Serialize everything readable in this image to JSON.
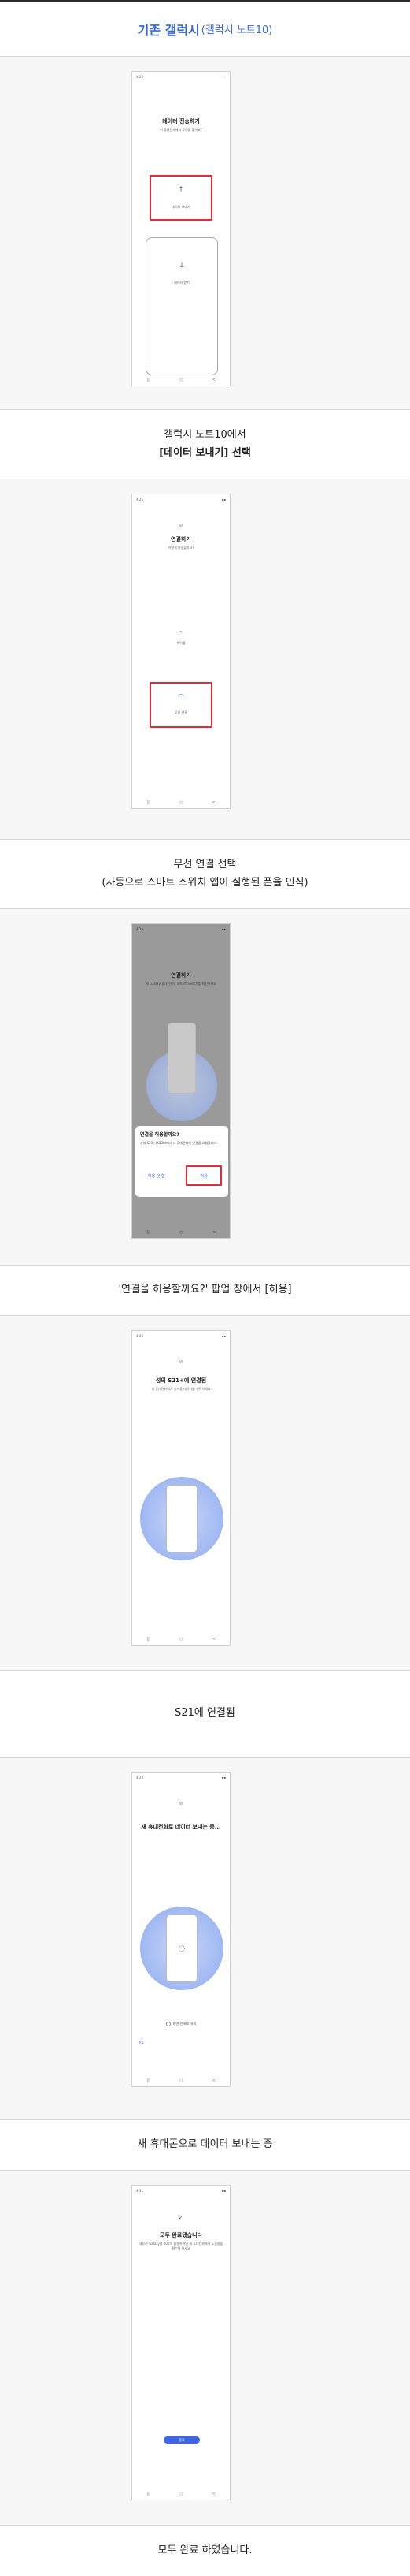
{
  "header": {
    "title_blue": "기존 갤럭시",
    "title_rest": "(갤럭시 노트10)"
  },
  "steps": [
    {
      "caption_lines": [
        "갤럭시 노트10에서",
        "[데이터 보내기] 선택"
      ],
      "phone": {
        "status_left": "4:25",
        "title": "데이터 전송하기",
        "subtitle": "이 휴대전화에서 무엇을 할까요?",
        "option1": "데이터 보내기",
        "option2": "데이터 받기"
      }
    },
    {
      "caption_lines": [
        "무선 연결 선택",
        "(자동으로 스마트 스위치 앱이 실행된 폰을 인식)"
      ],
      "phone": {
        "status_left": "4:25",
        "title": "연결하기",
        "subtitle": "어떻게 연결할까요?",
        "option1": "케이블",
        "option2": "무선 연결"
      }
    },
    {
      "caption_lines": [
        "'연결을 허용할까요?' 팝업 창에서 [허용]"
      ],
      "phone": {
        "status_left": "4:25",
        "title": "연결하기",
        "subtitle": "새 Galaxy 휴대전화의 Smart Switch를 확인하세요",
        "dialog_title": "연결을 허용할까요?",
        "dialog_text": "성의 S21+(X330)에서 내 휴대전화에 연결을 요청합니다.",
        "deny": "허용 안 함",
        "allow": "허용"
      }
    },
    {
      "caption_lines": [
        "S21에 연결됨"
      ],
      "phone": {
        "status_left": "4:26",
        "title": "성의 S21+에 연결됨",
        "subtitle": "새 휴대전화에서 가져올 데이터를 선택하세요"
      }
    },
    {
      "caption_lines": [
        "새 휴대폰으로 데이터 보내는 중"
      ],
      "phone": {
        "status_left": "4:28",
        "title": "새 휴대전화로 데이터 보내는 중...",
        "checkbox": "화면 전 배로 유지",
        "cancel": "취소"
      }
    },
    {
      "caption_lines": [
        "모두 완료 하였습니다."
      ],
      "phone": {
        "status_left": "4:31",
        "title": "모두 완료됐습니다",
        "subtitle": "새로운 Galaxy를 100% 활용하려면 새 휴대전화에서 도움말을 확인해 보세요",
        "button": "종료"
      }
    }
  ],
  "nav": {
    "recent": "|||",
    "home": "○",
    "back": "<"
  },
  "icons": {
    "upload": "↑",
    "download": "↓",
    "link": "⊘",
    "usb": "⌁",
    "wifi": "◠",
    "check": "✓",
    "spinner": "◌"
  },
  "colors": {
    "accent": "#3a69d8",
    "highlight": "#e22b3a",
    "button": "#3c68e6"
  }
}
